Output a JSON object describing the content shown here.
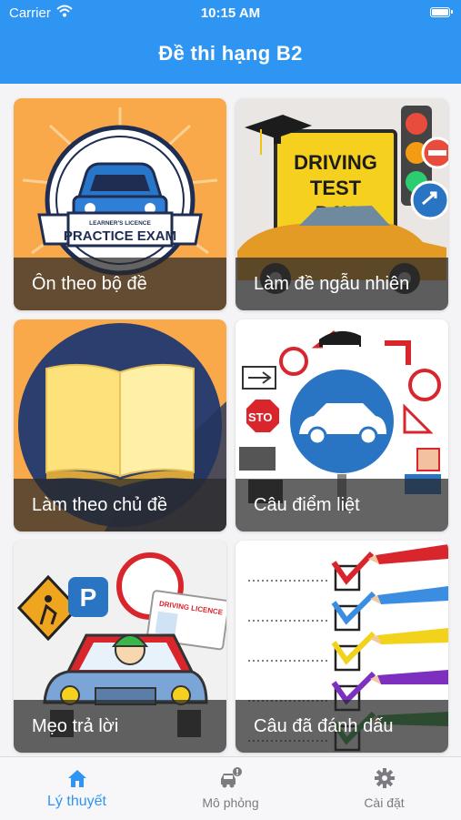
{
  "status": {
    "carrier": "Carrier",
    "time": "10:15 AM"
  },
  "header": {
    "title": "Đề thi hạng B2"
  },
  "cards": [
    {
      "label": "Ôn theo bộ đề",
      "badge_small": "LEARNER'S LICENCE",
      "badge_big": "PRACTICE EXAM"
    },
    {
      "label": "Làm đề ngẫu nhiên",
      "sign_lines": [
        "DRIVING",
        "TEST",
        "DAY"
      ]
    },
    {
      "label": "Làm theo chủ đề"
    },
    {
      "label": "Câu điểm liệt",
      "stop_text": "STO"
    },
    {
      "label": "Mẹo trả lời",
      "licence_text": "DRIVING LICENCE"
    },
    {
      "label": "Câu đã đánh dấu"
    }
  ],
  "tabs": [
    {
      "label": "Lý thuyết",
      "icon": "home-icon",
      "active": true
    },
    {
      "label": "Mô phỏng",
      "icon": "car-alert-icon",
      "active": false
    },
    {
      "label": "Cài đặt",
      "icon": "gear-icon",
      "active": false
    }
  ],
  "colors": {
    "primary": "#2f95f3",
    "card_orange": "#f9a94a",
    "tab_inactive": "#7b7b80"
  }
}
